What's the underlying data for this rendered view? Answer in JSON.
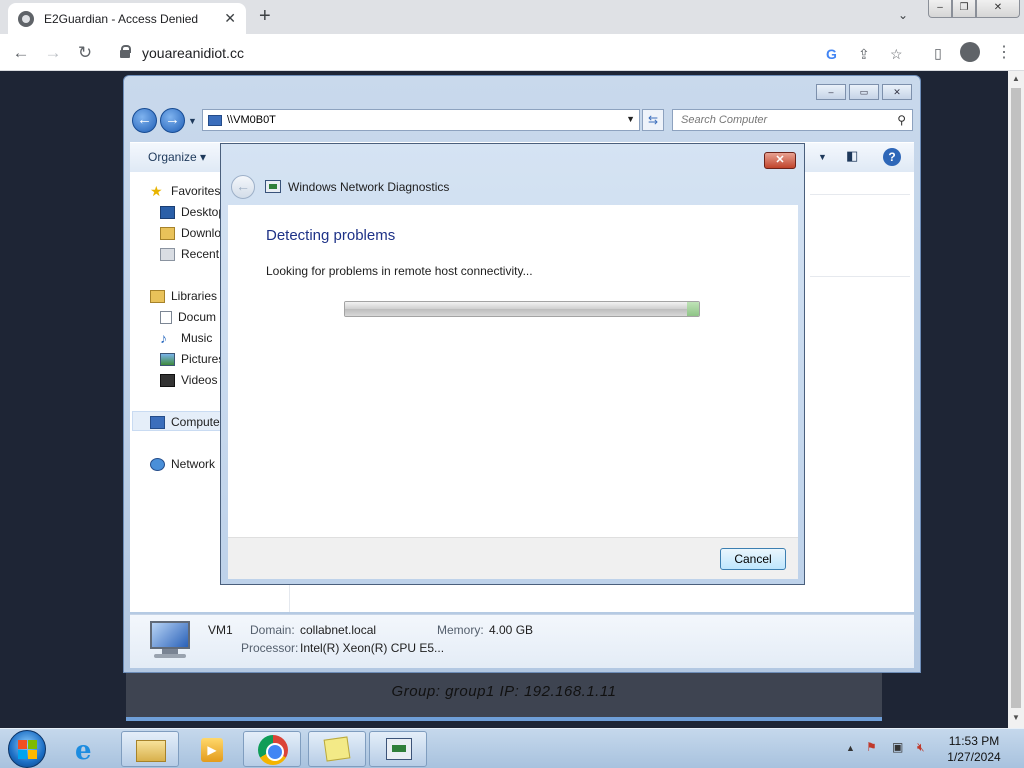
{
  "browser": {
    "tab_title": "E2Guardian - Access Denied",
    "tab_close": "✕",
    "new_tab": "+",
    "url": "youareanidiot.cc"
  },
  "explorer": {
    "address": "\\\\VM0B0T",
    "search_placeholder": "Search Computer",
    "organize": "Organize",
    "nav": {
      "favorites": "Favorites",
      "desktop": "Desktop",
      "downloads": "Downlo",
      "recent": "Recent",
      "libraries": "Libraries",
      "documents": "Docum",
      "music": "Music",
      "pictures": "Pictures",
      "videos": "Videos",
      "computer": "Compute",
      "network": "Network"
    },
    "details": {
      "name": "VM1",
      "domain_label": "Domain:",
      "domain": "collabnet.local",
      "memory_label": "Memory:",
      "memory": "4.00 GB",
      "processor_label": "Processor:",
      "processor": "Intel(R) Xeon(R) CPU E5..."
    }
  },
  "group_strip": "Group: group1   IP: 192.168.1.11",
  "dialog": {
    "title": "Windows Network Diagnostics",
    "heading": "Detecting problems",
    "message": "Looking for problems in remote host connectivity...",
    "progress": 1.0,
    "cancel": "Cancel"
  },
  "taskbar": {
    "time": "11:53 PM",
    "date": "1/27/2024"
  }
}
